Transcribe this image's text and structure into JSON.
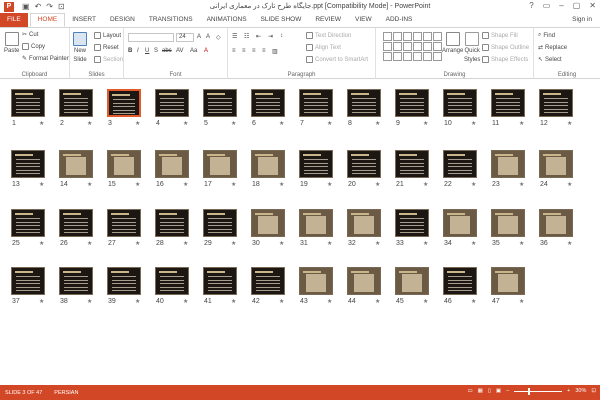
{
  "window": {
    "app_icon": "P",
    "title": "جایگاه طرح تارک در معماری ایرانی.ppt [Compatibility Mode] - PowerPoint",
    "qat": [
      "save-icon",
      "undo-icon",
      "redo-icon",
      "start-icon"
    ],
    "controls": [
      "?",
      "▭",
      "–",
      "▢",
      "✕"
    ]
  },
  "tabs": [
    {
      "label": "FILE",
      "kind": "file"
    },
    {
      "label": "HOME",
      "kind": "active"
    },
    {
      "label": "INSERT"
    },
    {
      "label": "DESIGN"
    },
    {
      "label": "TRANSITIONS"
    },
    {
      "label": "ANIMATIONS"
    },
    {
      "label": "SLIDE SHOW"
    },
    {
      "label": "REVIEW"
    },
    {
      "label": "VIEW"
    },
    {
      "label": "ADD-INS"
    }
  ],
  "signin": "Sign in",
  "ribbon": {
    "clipboard": {
      "paste": "Paste",
      "cut": "Cut",
      "copy": "Copy",
      "format_painter": "Format Painter",
      "label": "Clipboard"
    },
    "slides": {
      "new_slide": "New",
      "new_slide2": "Slide",
      "layout": "Layout",
      "reset": "Reset",
      "section": "Section",
      "label": "Slides"
    },
    "font": {
      "label": "Font",
      "size_value": "24",
      "buttons": [
        "B",
        "I",
        "U",
        "S",
        "abc",
        "AV",
        "Aa",
        "A"
      ]
    },
    "paragraph": {
      "text_direction": "Text Direction",
      "align_text": "Align Text",
      "convert": "Convert to SmartArt",
      "label": "Paragraph"
    },
    "drawing": {
      "arrange": "Arrange",
      "quick_styles": "Quick",
      "quick_styles2": "Styles",
      "shape_fill": "Shape Fill",
      "shape_outline": "Shape Outline",
      "shape_effects": "Shape Effects",
      "label": "Drawing"
    },
    "editing": {
      "find": "Find",
      "replace": "Replace",
      "select": "Select",
      "label": "Editing"
    }
  },
  "slides": {
    "selected": 3,
    "numbers": [
      1,
      2,
      3,
      4,
      5,
      6,
      7,
      8,
      9,
      10,
      11,
      12,
      13,
      14,
      15,
      16,
      17,
      18,
      19,
      20,
      21,
      22,
      23,
      24,
      25,
      26,
      27,
      28,
      29,
      30,
      31,
      32,
      33,
      34,
      35,
      36,
      37,
      38,
      39,
      40,
      41,
      42,
      43,
      44,
      45,
      46,
      47
    ],
    "star": "★"
  },
  "status": {
    "slide": "SLIDE 3 OF 47",
    "language": "PERSIAN",
    "zoom": "30%",
    "zoom_level": 0.3
  }
}
